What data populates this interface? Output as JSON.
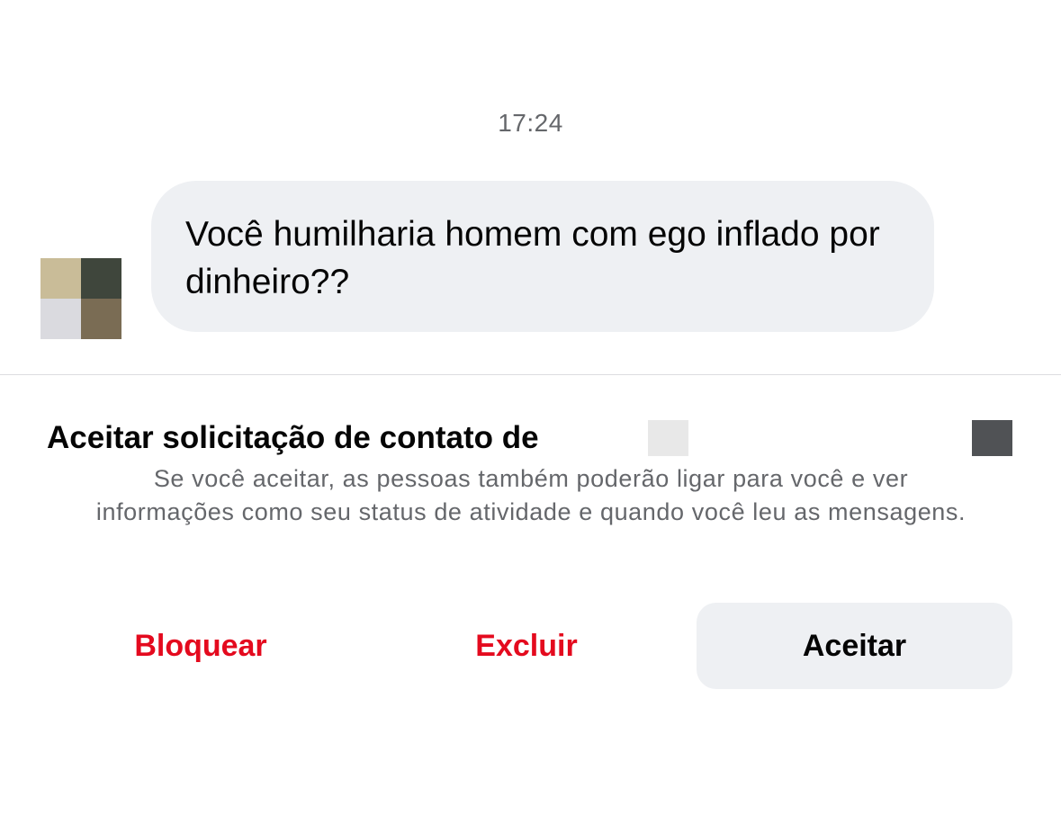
{
  "conversation": {
    "timestamp": "17:24",
    "message": {
      "text": "Você humilharia homem com ego inflado por dinheiro??",
      "avatar_colors": [
        "#c9bc98",
        "#3f463c",
        "#dadadf",
        "#7a6c54"
      ]
    }
  },
  "request": {
    "title": "Aceitar solicitação de contato de",
    "description": "Se você aceitar, as pessoas também poderão ligar para você e ver informações como seu status de atividade e quando você leu as mensagens.",
    "actions": {
      "block_label": "Bloquear",
      "delete_label": "Excluir",
      "accept_label": "Aceitar"
    }
  },
  "colors": {
    "destructive": "#e40a1e",
    "bubble_background": "#eef0f3",
    "secondary_text": "#65676b"
  }
}
